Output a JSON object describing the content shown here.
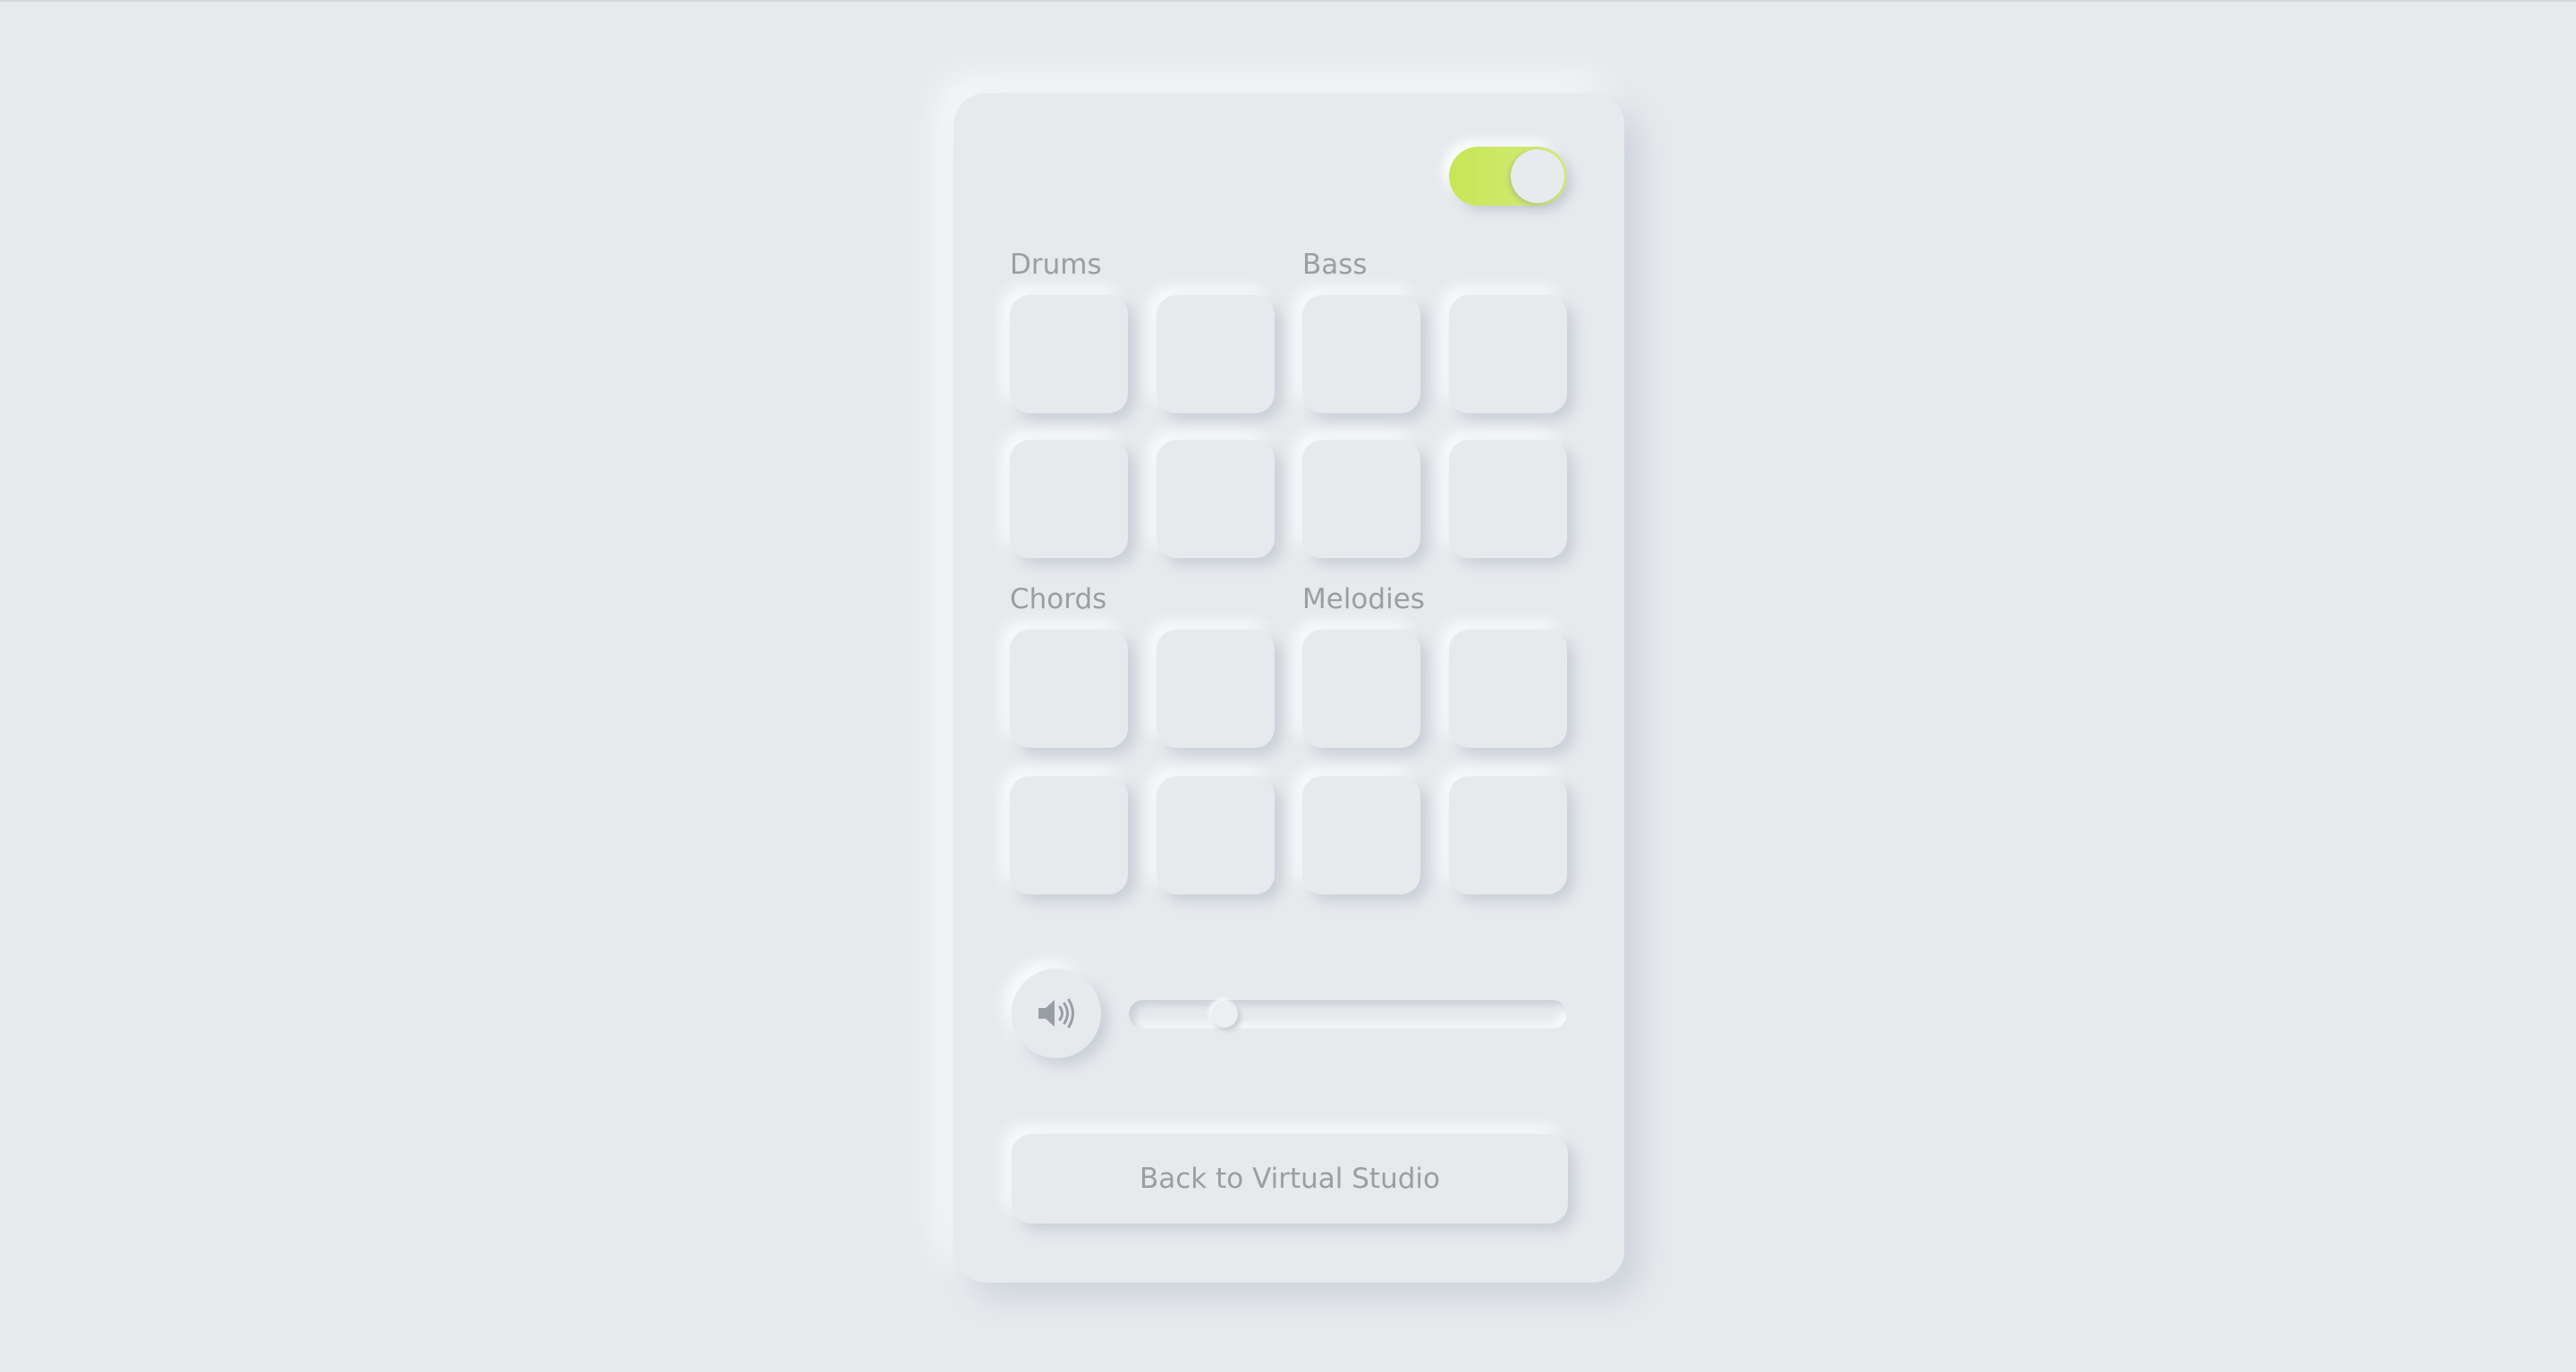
{
  "accent_color": "#c6e655",
  "toggle": {
    "state": "on"
  },
  "sections": [
    {
      "label": "Drums"
    },
    {
      "label": "Bass"
    },
    {
      "label": "Chords"
    },
    {
      "label": "Melodies"
    }
  ],
  "volume": {
    "icon": "speaker-icon",
    "level_fraction": 0.2
  },
  "back_button": {
    "label": "Back to Virtual Studio"
  }
}
